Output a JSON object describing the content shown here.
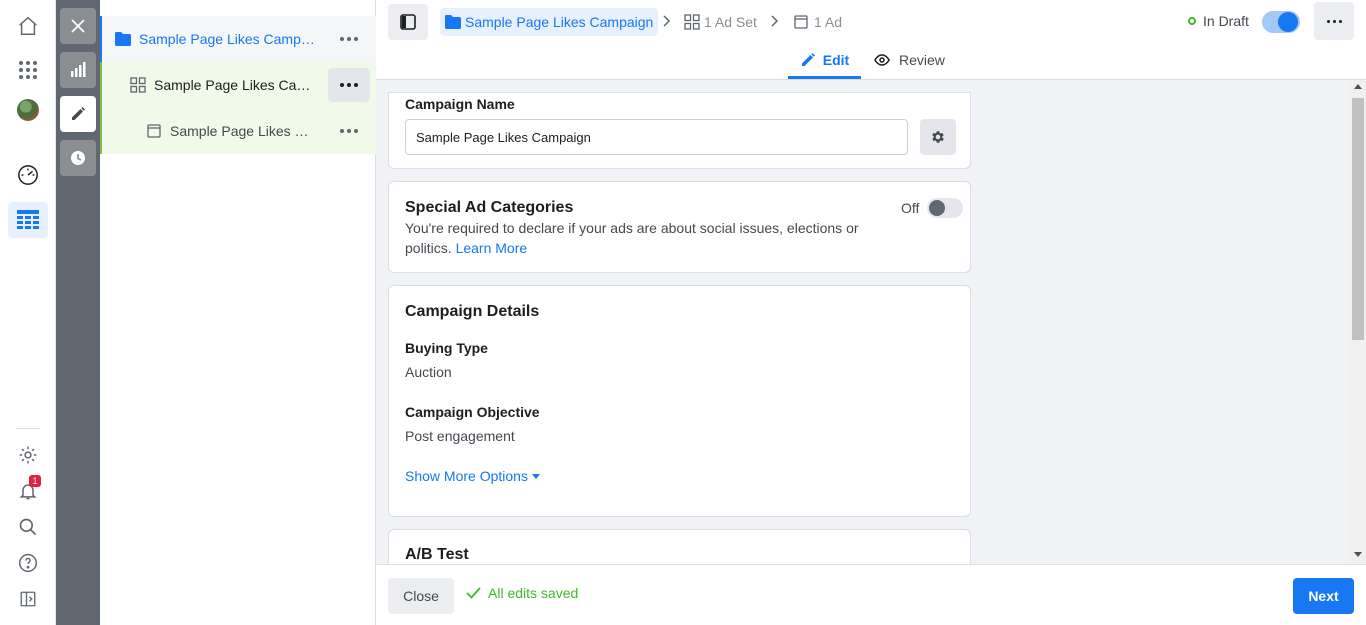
{
  "rail": {
    "notifications_count": "1"
  },
  "tree": {
    "campaign_label": "Sample Page Likes Campa...",
    "adset_label": "Sample Page Likes Cam...",
    "ad_label": "Sample Page Likes C..."
  },
  "breadcrumb": {
    "campaign": "Sample Page Likes Campaign",
    "adset": "1 Ad Set",
    "ad": "1 Ad"
  },
  "status": {
    "label": "In Draft"
  },
  "tabs": {
    "edit": "Edit",
    "review": "Review"
  },
  "campaign_name": {
    "label": "Campaign Name",
    "value": "Sample Page Likes Campaign"
  },
  "special_ad": {
    "title": "Special Ad Categories",
    "description": "You're required to declare if your ads are about social issues, elections or politics.",
    "learn_more": "Learn More",
    "toggle_label": "Off"
  },
  "campaign_details": {
    "title": "Campaign Details",
    "buying_type_label": "Buying Type",
    "buying_type_value": "Auction",
    "objective_label": "Campaign Objective",
    "objective_value": "Post engagement",
    "show_more": "Show More Options"
  },
  "ab_test": {
    "title": "A/B Test"
  },
  "footer": {
    "close": "Close",
    "saved": "All edits saved",
    "next": "Next"
  },
  "colors": {
    "accent": "#1877f2",
    "selected_bg": "#f1f9e8",
    "selected_border": "#7cc242",
    "saved_green": "#42b72a",
    "draft_dot": "#42b72a"
  }
}
